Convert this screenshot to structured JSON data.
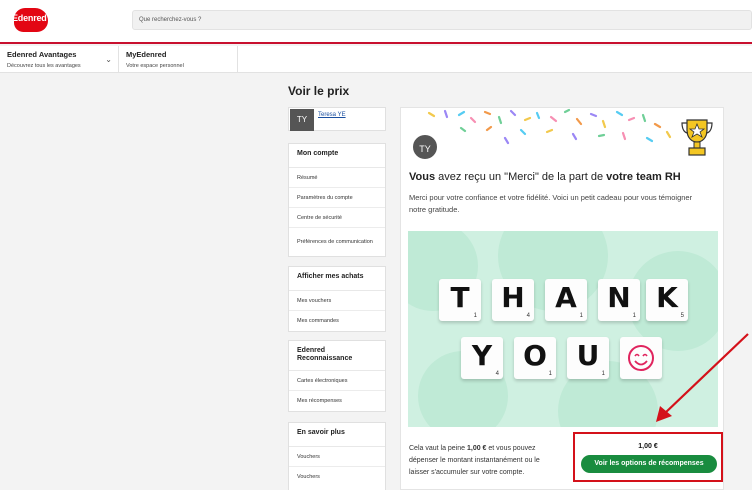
{
  "header": {
    "logo_text": "Edenred",
    "brand_color": "#e30613",
    "search_placeholder": "Que recherchez-vous ?"
  },
  "nav": {
    "items": [
      {
        "title": "Edenred Avantages",
        "subtitle": "Découvrez tous les avantages"
      },
      {
        "title": "MyEdenred",
        "subtitle": "Votre espace personnel"
      }
    ]
  },
  "page_title": "Voir le prix",
  "user": {
    "initials": "TY",
    "name": "Teresa YE"
  },
  "sidebar": {
    "sections": [
      {
        "heading": "Mon compte",
        "items": [
          "Résumé",
          "Paramètres du compte",
          "Centre de sécurité",
          "Préférences de communication"
        ]
      },
      {
        "heading": "Afficher mes achats",
        "items": [
          "Mes vouchers",
          "Mes commandes"
        ]
      },
      {
        "heading": "Edenred Reconnaissance",
        "items": [
          "Cartes électroniques",
          "Mes récompenses"
        ]
      },
      {
        "heading": "En savoir plus",
        "items": [
          "Vouchers",
          "Vouchers"
        ]
      }
    ]
  },
  "card": {
    "avatar_initials": "TY",
    "headline_pre": "Vous",
    "headline_mid": " avez reçu un \"Merci\" de la part de ",
    "headline_team": "votre team RH",
    "description": "Merci pour votre confiance et votre fidélité. Voici un petit cadeau pour vous témoigner notre gratitude.",
    "tiles_row1": [
      {
        "letter": "T",
        "num": "1"
      },
      {
        "letter": "H",
        "num": "4"
      },
      {
        "letter": "A",
        "num": "1"
      },
      {
        "letter": "N",
        "num": "1"
      },
      {
        "letter": "K",
        "num": "5"
      }
    ],
    "tiles_row2": [
      {
        "letter": "Y",
        "num": "4"
      },
      {
        "letter": "O",
        "num": "1"
      },
      {
        "letter": "U",
        "num": "1"
      }
    ],
    "value_pre": "Cela vaut la peine ",
    "value_amount": "1,00 €",
    "value_post": " et vous pouvez dépenser le montant instantanément ou le laisser s'accumuler sur votre compte."
  },
  "reward": {
    "price": "1,00 €",
    "button_label": "Voir les options de récompenses",
    "button_color": "#198c3f",
    "highlight_color": "#d4111a"
  }
}
